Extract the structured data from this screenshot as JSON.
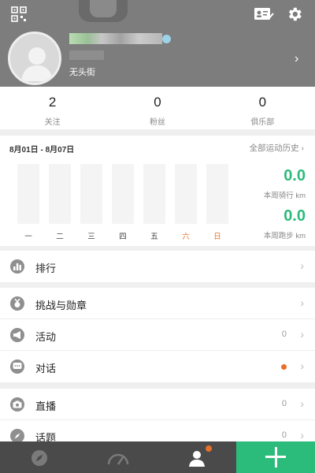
{
  "profile": {
    "nickname": "无头街"
  },
  "stats": [
    {
      "value": "2",
      "label": "关注"
    },
    {
      "value": "0",
      "label": "粉丝"
    },
    {
      "value": "0",
      "label": "俱乐部"
    }
  ],
  "week": {
    "range": "8月01日 - 8月07日",
    "history_link": "全部运动历史 ›",
    "days": [
      "一",
      "二",
      "三",
      "四",
      "五",
      "六",
      "日"
    ],
    "cycling_value": "0.0",
    "cycling_label": "本周骑行 km",
    "running_value": "0.0",
    "running_label": "本周跑步 km"
  },
  "menu": {
    "ranking": {
      "label": "排行",
      "icon": "bar-chart-icon"
    },
    "challenges": {
      "label": "挑战与勋章",
      "icon": "medal-icon"
    },
    "activities": {
      "label": "活动",
      "icon": "megaphone-icon",
      "count": "0"
    },
    "conversations": {
      "label": "对话",
      "icon": "chat-icon"
    },
    "live": {
      "label": "直播",
      "icon": "camera-icon",
      "count": "0"
    },
    "topics": {
      "label": "话题",
      "icon": "compass-icon",
      "count": "0"
    }
  },
  "colors": {
    "accent": "#2bbb7b",
    "badge": "#e8702a",
    "header": "#7d7d7d",
    "tabbar": "#4a4a4a"
  }
}
